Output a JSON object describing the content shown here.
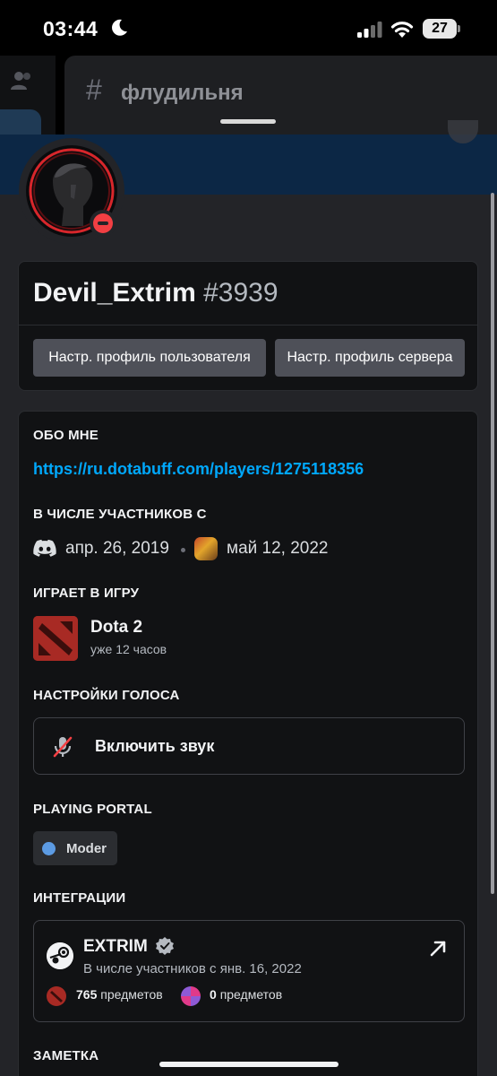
{
  "status_bar": {
    "time": "03:44",
    "battery": "27"
  },
  "background": {
    "channel_name": "флудильня"
  },
  "profile": {
    "username": "Devil_Extrim",
    "discriminator": "#3939",
    "status": "do-not-disturb"
  },
  "buttons": {
    "edit_user_profile": "Настр. профиль пользователя",
    "edit_server_profile": "Настр. профиль сервера"
  },
  "about": {
    "heading": "ОБО МНЕ",
    "link": "https://ru.dotabuff.com/players/1275118356"
  },
  "member_since": {
    "heading": "В ЧИСЛЕ УЧАСТНИКОВ С",
    "discord_date": "апр. 26, 2019",
    "server_date": "май 12, 2022"
  },
  "activity": {
    "heading": "ИГРАЕТ В ИГРУ",
    "game": "Dota 2",
    "elapsed": "уже 12 часов"
  },
  "voice": {
    "heading": "НАСТРОЙКИ ГОЛОСА",
    "unmute_label": "Включить звук"
  },
  "roles": {
    "heading": "PLAYING PORTAL",
    "items": [
      {
        "name": "Moder",
        "color": "#5c9be3"
      }
    ]
  },
  "integrations": {
    "heading": "ИНТЕГРАЦИИ",
    "account_name": "EXTRIM",
    "member_since": "В числе участников с янв. 16, 2022",
    "stat1_count": "765",
    "stat1_unit": "предметов",
    "stat2_count": "0",
    "stat2_unit": "предметов"
  },
  "note": {
    "heading": "ЗАМЕТКА"
  },
  "colors": {
    "accent_link": "#00a8fc",
    "dnd_red": "#f23f43",
    "banner": "#0c2745"
  }
}
